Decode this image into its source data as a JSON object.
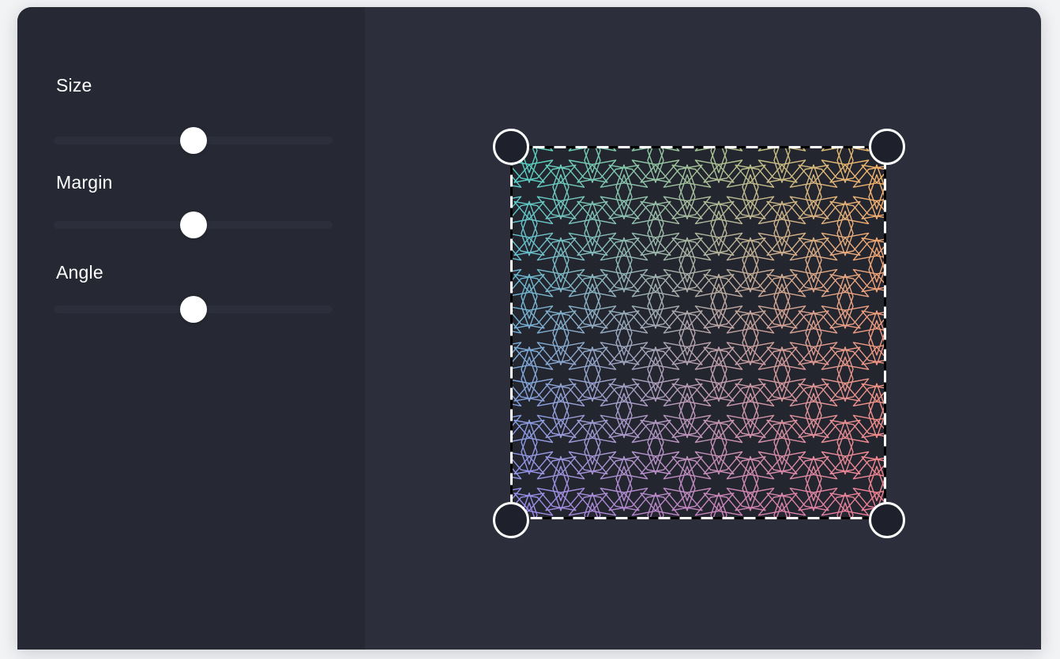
{
  "controls": {
    "size": {
      "label": "Size",
      "value": 0.5
    },
    "margin": {
      "label": "Margin",
      "value": 0.5
    },
    "angle": {
      "label": "Angle",
      "value": 0.5
    }
  },
  "pattern": {
    "shape": "rhombus",
    "gradient": {
      "top_left": "#4fd6c4",
      "top_right": "#f8b866",
      "bottom_left": "#9a8cf0",
      "bottom_right": "#f47e94"
    },
    "selection_border": "dashed-white"
  },
  "colors": {
    "window_bg": "#2c2f3b",
    "sidebar_bg": "#262833",
    "track": "#2c2f3b",
    "thumb": "#ffffff",
    "handle_fill": "#1e202b",
    "handle_border": "#ffffff"
  }
}
